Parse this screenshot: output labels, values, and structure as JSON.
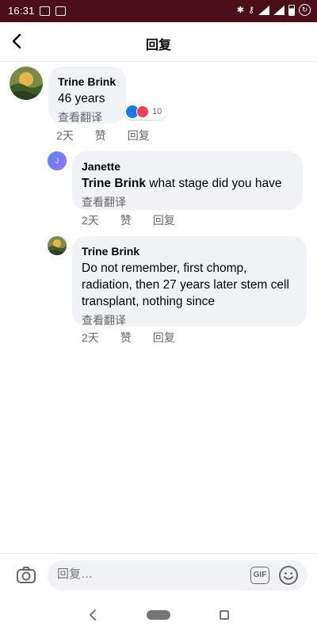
{
  "status_bar": {
    "time": "16:31",
    "battery_label": "4G"
  },
  "header": {
    "title": "回复"
  },
  "comments": [
    {
      "author": "Trine Brink",
      "text": "46 years",
      "translate": "查看翻译",
      "reactions": {
        "count": "10",
        "types": [
          "like-icon",
          "love-icon"
        ]
      },
      "actions": {
        "time": "2天",
        "like": "赞",
        "reply": "回复"
      }
    },
    {
      "author": "Janette",
      "avatar_letter": "J",
      "mention": "Trine Brink",
      "text": " what stage did you have",
      "translate": "查看翻译",
      "actions": {
        "time": "2天",
        "like": "赞",
        "reply": "回复"
      }
    },
    {
      "author": "Trine Brink",
      "text": "Do not remember, first chomp, radiation, then 27 years later stem cell transplant, nothing since",
      "translate": "查看翻译",
      "actions": {
        "time": "2天",
        "like": "赞",
        "reply": "回复"
      }
    }
  ],
  "composer": {
    "placeholder": "回复…",
    "gif_label": "GIF"
  },
  "colors": {
    "status_bar_bg": "#4a0f18",
    "bubble_bg": "#f0f2f5",
    "like_blue": "#1877f2",
    "love_red": "#f33e58",
    "secondary_text": "#65676b"
  }
}
